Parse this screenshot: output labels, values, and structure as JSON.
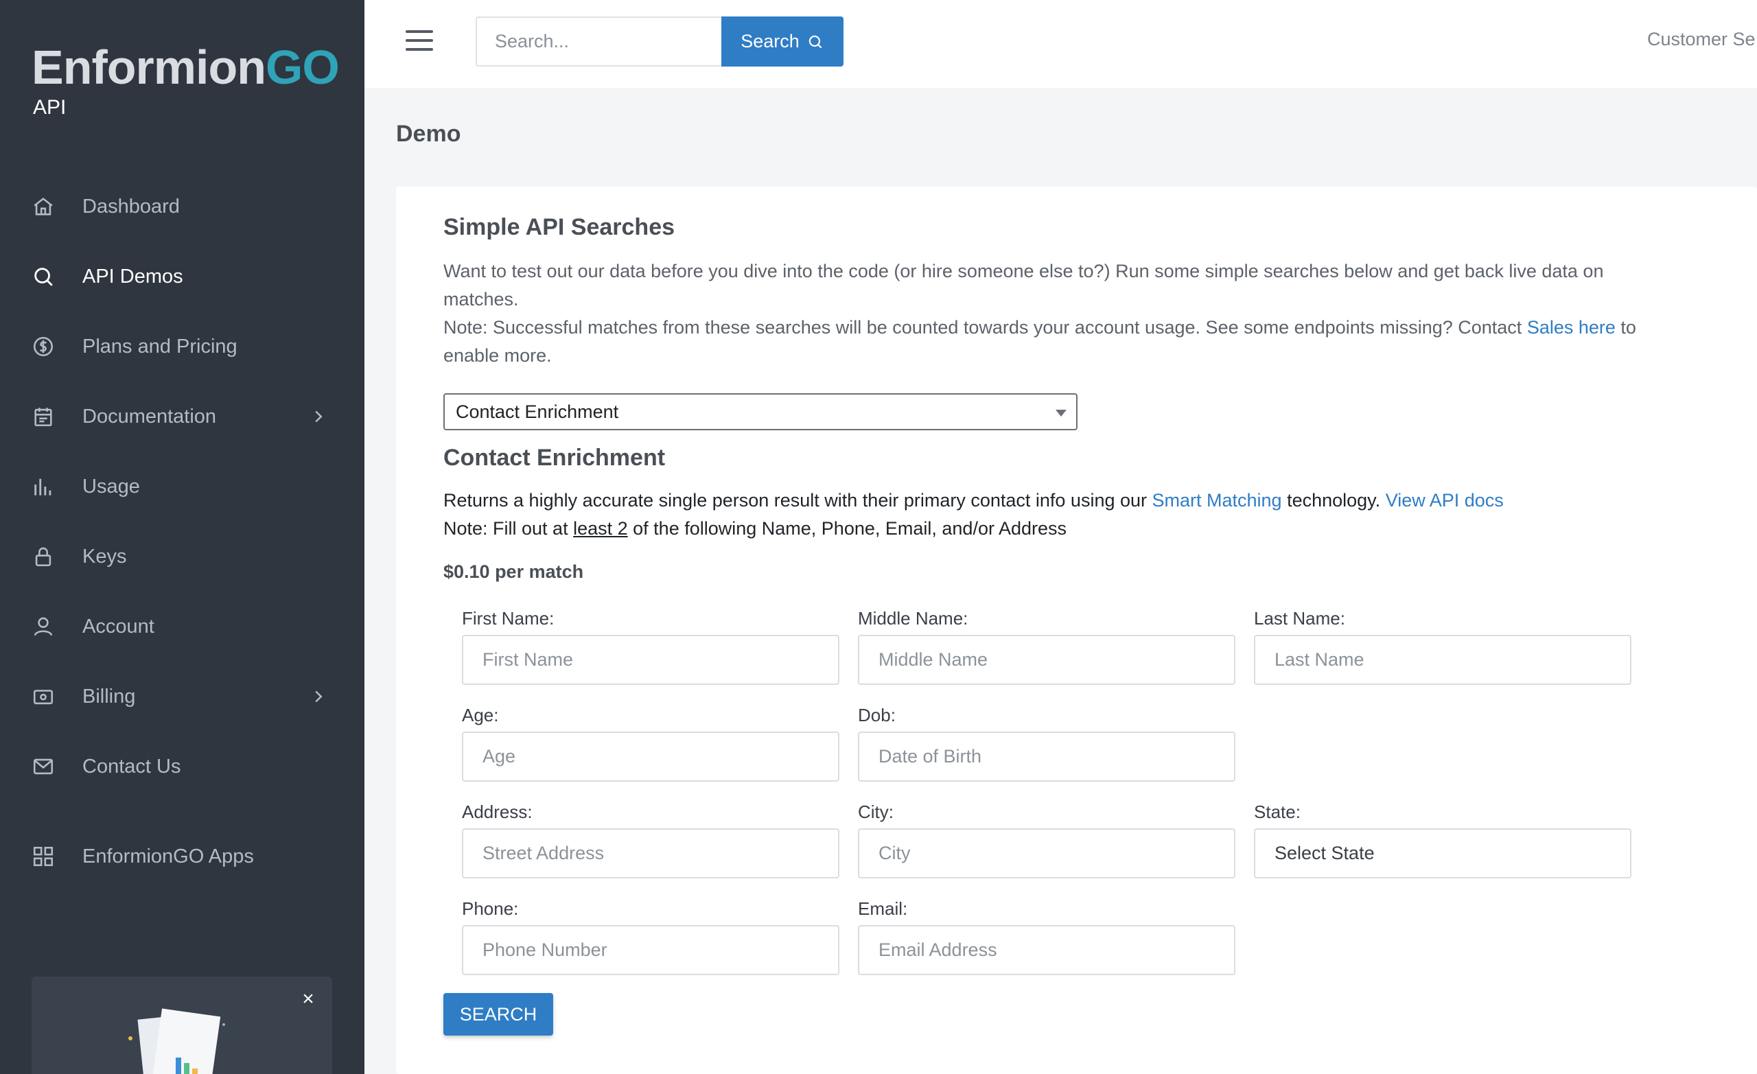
{
  "brand": {
    "name_part1": "Enf",
    "name_o": "o",
    "name_part2": "rmion",
    "name_go": "GO",
    "subtitle": "API"
  },
  "sidebar": {
    "items": [
      {
        "label": "Dashboard",
        "icon": "home-icon"
      },
      {
        "label": "API Demos",
        "icon": "search-icon"
      },
      {
        "label": "Plans and Pricing",
        "icon": "dollar-circle-icon"
      },
      {
        "label": "Documentation",
        "icon": "calendar-icon"
      },
      {
        "label": "Usage",
        "icon": "bar-chart-icon"
      },
      {
        "label": "Keys",
        "icon": "lock-icon"
      },
      {
        "label": "Account",
        "icon": "user-icon"
      },
      {
        "label": "Billing",
        "icon": "wallet-icon"
      },
      {
        "label": "Contact Us",
        "icon": "mail-icon"
      }
    ],
    "apps_label": "EnformionGO Apps",
    "promo_close": "×"
  },
  "topbar": {
    "search_placeholder": "Search...",
    "search_button": "Search",
    "customer_label": "Customer Se"
  },
  "page": {
    "title": "Demo",
    "card_title": "Simple API Searches",
    "intro_line1": "Want to test out our data before you dive into the code (or hire someone else to?) Run some simple searches below and get back live data on matches.",
    "intro_note_pre": "Note: Successful matches from these searches will be counted towards your account usage. See some endpoints missing? Contact ",
    "intro_note_link": "Sales here",
    "intro_note_post": " to enable more.",
    "selected_endpoint": "Contact Enrichment",
    "section_title": "Contact Enrichment",
    "desc_pre": "Returns a highly accurate single person result with their primary contact info using our ",
    "desc_link1": "Smart Matching",
    "desc_mid": " technology. ",
    "desc_link2": "View API docs",
    "note_pre": "Note: Fill out at ",
    "note_underline": "least 2",
    "note_post": " of the following Name, Phone, Email, and/or Address",
    "price": "$0.10 per match",
    "submit_label": "SEARCH"
  },
  "form": {
    "first_name": {
      "label": "First Name:",
      "placeholder": "First Name"
    },
    "middle_name": {
      "label": "Middle Name:",
      "placeholder": "Middle Name"
    },
    "last_name": {
      "label": "Last Name:",
      "placeholder": "Last Name"
    },
    "age": {
      "label": "Age:",
      "placeholder": "Age"
    },
    "dob": {
      "label": "Dob:",
      "placeholder": "Date of Birth"
    },
    "address": {
      "label": "Address:",
      "placeholder": "Street Address"
    },
    "city": {
      "label": "City:",
      "placeholder": "City"
    },
    "state": {
      "label": "State:",
      "value": "Select State"
    },
    "phone": {
      "label": "Phone:",
      "placeholder": "Phone Number"
    },
    "email": {
      "label": "Email:",
      "placeholder": "Email Address"
    }
  },
  "colors": {
    "sidebar_bg": "#2f3640",
    "accent": "#2f7dc5",
    "brand_go": "#2fa3b8"
  }
}
